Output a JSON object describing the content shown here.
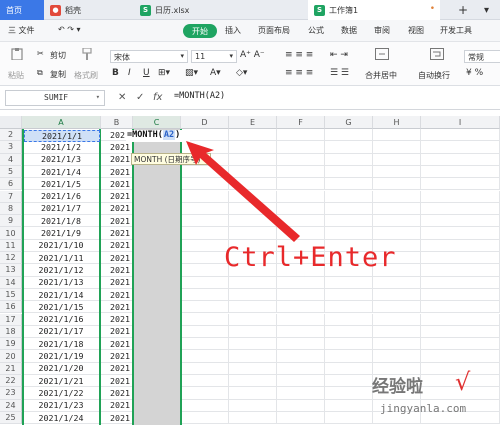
{
  "tabs": [
    {
      "label": "首页"
    },
    {
      "label": "稻壳"
    },
    {
      "label": "日历.xlsx"
    },
    {
      "label": "工作簿1"
    }
  ],
  "menus": [
    "三 文件",
    "开始",
    "插入",
    "页面布局",
    "公式",
    "数据",
    "审阅",
    "视图",
    "开发工具"
  ],
  "ribbon": {
    "cut": "剪切",
    "paste": "粘贴",
    "copy": "复制",
    "format_painter": "格式刷",
    "font_name": "宋体",
    "font_size": "11",
    "merge_center": "合并居中",
    "auto_wrap": "自动换行",
    "number_format": "常规"
  },
  "formula_bar": {
    "name_box": "SUMIF",
    "cancel": "✕",
    "confirm": "✓",
    "fx": "fx",
    "content": "=MONTH(A2)"
  },
  "columns": [
    "A",
    "B",
    "C",
    "D",
    "E",
    "F",
    "G",
    "H",
    "I"
  ],
  "rows": [
    {
      "num": "2",
      "a": "2021/1/1",
      "b": "2021"
    },
    {
      "num": "3",
      "a": "2021/1/2",
      "b": "2021"
    },
    {
      "num": "4",
      "a": "2021/1/3",
      "b": "2021"
    },
    {
      "num": "5",
      "a": "2021/1/4",
      "b": "2021"
    },
    {
      "num": "6",
      "a": "2021/1/5",
      "b": "2021"
    },
    {
      "num": "7",
      "a": "2021/1/6",
      "b": "2021"
    },
    {
      "num": "8",
      "a": "2021/1/7",
      "b": "2021"
    },
    {
      "num": "9",
      "a": "2021/1/8",
      "b": "2021"
    },
    {
      "num": "10",
      "a": "2021/1/9",
      "b": "2021"
    },
    {
      "num": "11",
      "a": "2021/1/10",
      "b": "2021"
    },
    {
      "num": "12",
      "a": "2021/1/11",
      "b": "2021"
    },
    {
      "num": "13",
      "a": "2021/1/12",
      "b": "2021"
    },
    {
      "num": "14",
      "a": "2021/1/13",
      "b": "2021"
    },
    {
      "num": "15",
      "a": "2021/1/14",
      "b": "2021"
    },
    {
      "num": "16",
      "a": "2021/1/15",
      "b": "2021"
    },
    {
      "num": "17",
      "a": "2021/1/16",
      "b": "2021"
    },
    {
      "num": "18",
      "a": "2021/1/17",
      "b": "2021"
    },
    {
      "num": "19",
      "a": "2021/1/18",
      "b": "2021"
    },
    {
      "num": "20",
      "a": "2021/1/19",
      "b": "2021"
    },
    {
      "num": "21",
      "a": "2021/1/20",
      "b": "2021"
    },
    {
      "num": "22",
      "a": "2021/1/21",
      "b": "2021"
    },
    {
      "num": "23",
      "a": "2021/1/22",
      "b": "2021"
    },
    {
      "num": "24",
      "a": "2021/1/23",
      "b": "2021"
    },
    {
      "num": "25",
      "a": "2021/1/24",
      "b": "2021"
    }
  ],
  "cell_edit": {
    "prefix": "=MONTH(",
    "ref": "A2",
    "suffix": ")"
  },
  "tooltip": "MONTH (日期序号)",
  "annotation": "Ctrl+Enter",
  "watermark": {
    "text": "经验啦",
    "url": "jingyanla.com",
    "check": "√"
  },
  "colors": {
    "accent_green": "#20a256",
    "home_tab": "#3b78e7",
    "annotation_red": "#e8292b"
  }
}
